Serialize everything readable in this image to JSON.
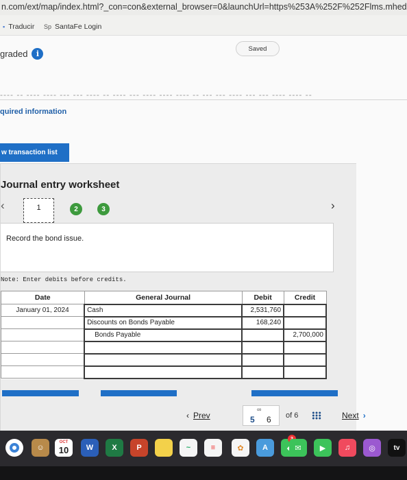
{
  "browser": {
    "url_main": "n.com/ext/map/index.html?_con=con&external_browser=0&launchUrl=https%253A%252F%252Flms.mhed",
    "bookmarks": [
      {
        "icon": "translate-icon",
        "label": "Traducir"
      },
      {
        "icon": "sp-logo",
        "label": "SantaFe Login"
      }
    ]
  },
  "header": {
    "graded_label": "graded",
    "saved_label": "Saved",
    "cutoff_text": "---- -- ---- ---- --- --- ---- -- ---- --- ---- ---- ---- -- --- --- ---- --- --- ---- ---- --"
  },
  "nav": {
    "required_info": "quired information",
    "view_transaction_list": "w transaction list"
  },
  "worksheet": {
    "title": "Journal entry worksheet",
    "steps": [
      "1",
      "2",
      "3"
    ],
    "instruction": "Record the bond issue.",
    "note": "Note: Enter debits before credits.",
    "columns": {
      "date": "Date",
      "journal": "General Journal",
      "debit": "Debit",
      "credit": "Credit"
    },
    "rows": [
      {
        "date": "January 01, 2024",
        "account": "Cash",
        "debit": "2,531,760",
        "credit": "",
        "indent": false
      },
      {
        "date": "",
        "account": "Discounts on Bonds Payable",
        "debit": "168,240",
        "credit": "",
        "indent": false
      },
      {
        "date": "",
        "account": "Bonds Payable",
        "debit": "",
        "credit": "2,700,000",
        "indent": true
      },
      {
        "date": "",
        "account": "",
        "debit": "",
        "credit": "",
        "indent": false
      },
      {
        "date": "",
        "account": "",
        "debit": "",
        "credit": "",
        "indent": false
      },
      {
        "date": "",
        "account": "",
        "debit": "",
        "credit": "",
        "indent": false
      }
    ]
  },
  "pager": {
    "prev_label": "Prev",
    "current_page": "5",
    "total_question": "6",
    "of_label": "of 6",
    "next_label": "Next"
  },
  "dock": {
    "calendar_month": "OCT",
    "calendar_day": "10",
    "notification_badge": "3",
    "tv_label": "tv"
  }
}
